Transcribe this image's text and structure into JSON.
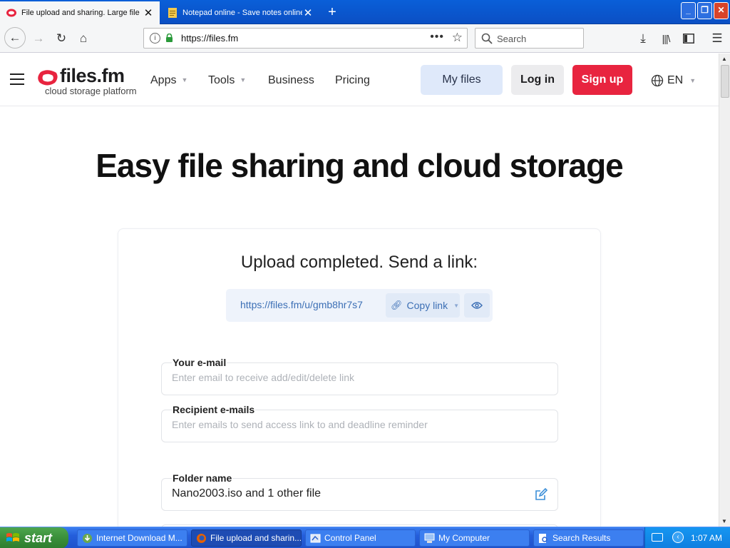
{
  "browser": {
    "tabs": [
      {
        "title": "File upload and sharing. Large file",
        "active": true
      },
      {
        "title": "Notepad online - Save notes online",
        "active": false
      }
    ],
    "new_tab": "+",
    "url": "https://files.fm",
    "search_placeholder": "Search"
  },
  "site": {
    "logo_name": "files.fm",
    "logo_tagline": "cloud storage platform",
    "nav": {
      "apps": "Apps",
      "tools": "Tools",
      "business": "Business",
      "pricing": "Pricing"
    },
    "buttons": {
      "my_files": "My files",
      "log_in": "Log in",
      "sign_up": "Sign up"
    },
    "language": "EN",
    "brand_color": "#e8243f"
  },
  "hero_title": "Easy file sharing and cloud storage",
  "upload": {
    "status": "Upload completed. Send a link:",
    "link": "https://files.fm/u/gmb8hr7s7",
    "copy_link": "Copy link",
    "your_email_label": "Your e-mail",
    "your_email_placeholder": "Enter email to receive add/edit/delete link",
    "recipients_label": "Recipient e-mails",
    "recipients_placeholder": "Enter emails to send access link to and deadline reminder",
    "folder_label": "Folder name",
    "folder_value": "Nano2003.iso and 1 other file"
  },
  "taskbar": {
    "start": "start",
    "tasks": [
      {
        "label": "Internet Download M...",
        "active": false
      },
      {
        "label": "File upload and sharin...",
        "active": true
      },
      {
        "label": "Control Panel",
        "active": false
      },
      {
        "label": "My Computer",
        "active": false
      },
      {
        "label": "Search Results",
        "active": false
      }
    ],
    "clock": "1:07 AM"
  }
}
